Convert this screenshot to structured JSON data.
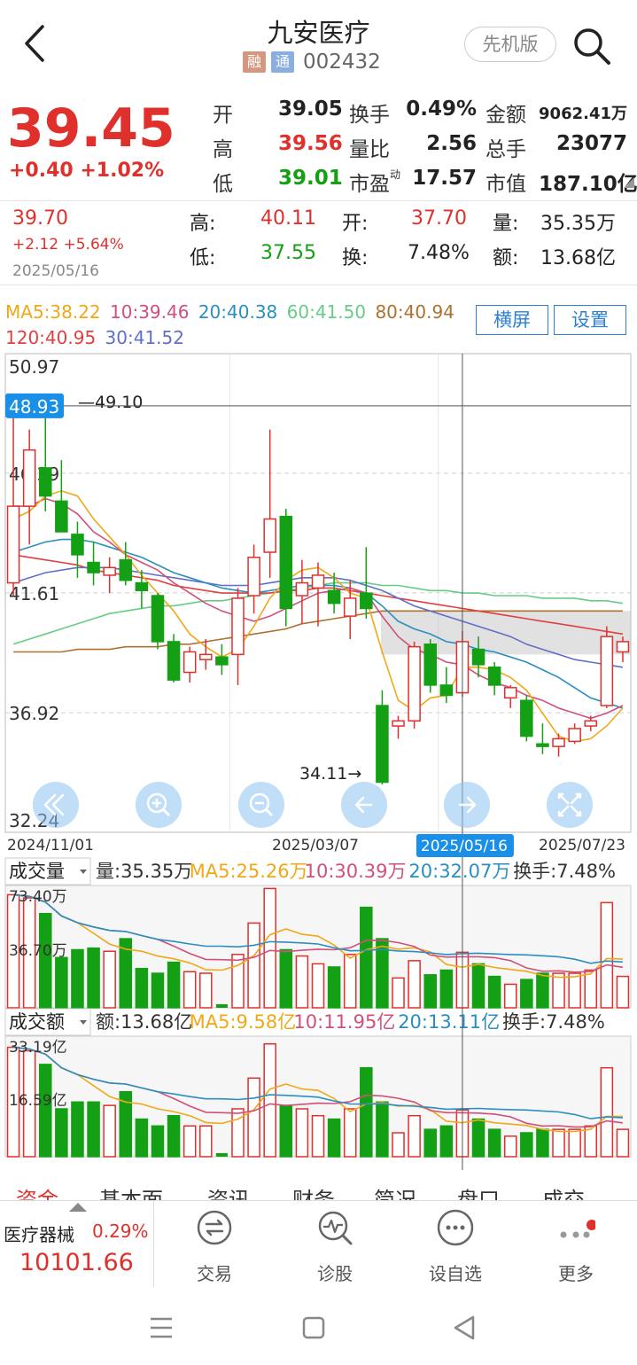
{
  "header": {
    "stock_name": "九安医疗",
    "tag_rong": "融",
    "tag_tong": "通",
    "stock_code": "002432",
    "version_label": "先机版"
  },
  "quote": {
    "price": "39.45",
    "change": "+0.40  +1.02%",
    "rows": [
      {
        "l1": "开",
        "v1": "39.05",
        "c1": "dark",
        "l2": "换手",
        "v2": "0.49%",
        "l3": "金额",
        "v3": "9062.41万"
      },
      {
        "l1": "高",
        "v1": "39.56",
        "c1": "red",
        "l2": "量比",
        "v2": "2.56",
        "l3": "总手",
        "v3": "23077"
      },
      {
        "l1": "低",
        "v1": "39.01",
        "c1": "green",
        "l2": "市盈",
        "v2": "17.57",
        "l3": "市值",
        "v3": "187.10亿"
      }
    ],
    "pe_superscript": "动"
  },
  "day_info": {
    "price": "39.70",
    "change": "+2.12  +5.64%",
    "date": "2025/05/16",
    "high_label": "高:",
    "high": "40.11",
    "open_label": "开:",
    "open": "37.70",
    "vol_label": "量:",
    "vol": "35.35万",
    "low_label": "低:",
    "low": "37.55",
    "turn_label": "换:",
    "turn": "7.48%",
    "amount_label": "额:",
    "amount": "13.68亿"
  },
  "ma_legend": {
    "ma5": "MA5:38.22",
    "ma10": "10:39.46",
    "ma20": "20:40.38",
    "ma60": "60:41.50",
    "ma80": "80:40.94",
    "ma120": "120:40.95",
    "ma30": "30:41.52"
  },
  "buttons": {
    "landscape": "横屏",
    "settings": "设置"
  },
  "colors": {
    "up": "#e0302c",
    "down": "#14a014",
    "ma5": "#f0a818",
    "ma10": "#d0507a",
    "ma20": "#2a8fc0",
    "ma30": "#6070c8",
    "ma60": "#66cc88",
    "ma80": "#b07030",
    "ma120": "#e04040",
    "crosshair": "#555555",
    "date_badge": "#1a8fe8"
  },
  "chart_data": [
    {
      "type": "candlestick",
      "title": "",
      "ylim": [
        32.24,
        50.97
      ],
      "y_ticks": [
        "50.97",
        "46.29",
        "41.61",
        "36.92",
        "32.24"
      ],
      "x_labels": [
        "2024/11/01",
        "2025/03/07",
        "2025/05/16",
        "2025/07/23"
      ],
      "crosshair_price": "48.93",
      "crosshair_date": "2025/05/16",
      "annotations": {
        "max": "49.10",
        "min": "34.11"
      },
      "candles": [
        {
          "o": 42.0,
          "h": 48.5,
          "l": 41.5,
          "c": 45.0
        },
        {
          "o": 45.0,
          "h": 48.0,
          "l": 43.5,
          "c": 47.2
        },
        {
          "o": 46.5,
          "h": 49.1,
          "l": 44.8,
          "c": 45.4
        },
        {
          "o": 45.2,
          "h": 46.8,
          "l": 44.0,
          "c": 44.0
        },
        {
          "o": 43.9,
          "h": 44.4,
          "l": 42.2,
          "c": 43.1
        },
        {
          "o": 42.8,
          "h": 43.6,
          "l": 41.9,
          "c": 42.4
        },
        {
          "o": 42.3,
          "h": 43.0,
          "l": 41.6,
          "c": 42.6
        },
        {
          "o": 42.9,
          "h": 43.6,
          "l": 41.9,
          "c": 42.1
        },
        {
          "o": 42.0,
          "h": 42.5,
          "l": 41.0,
          "c": 41.7
        },
        {
          "o": 41.5,
          "h": 41.6,
          "l": 39.4,
          "c": 39.7
        },
        {
          "o": 39.7,
          "h": 40.0,
          "l": 38.1,
          "c": 38.2
        },
        {
          "o": 38.5,
          "h": 39.5,
          "l": 38.1,
          "c": 39.3
        },
        {
          "o": 39.0,
          "h": 39.8,
          "l": 38.6,
          "c": 39.2
        },
        {
          "o": 39.1,
          "h": 39.6,
          "l": 38.4,
          "c": 38.8
        },
        {
          "o": 39.2,
          "h": 41.8,
          "l": 38.0,
          "c": 41.4
        },
        {
          "o": 41.5,
          "h": 43.5,
          "l": 40.8,
          "c": 43.0
        },
        {
          "o": 43.2,
          "h": 48.0,
          "l": 42.2,
          "c": 44.5
        },
        {
          "o": 44.6,
          "h": 44.9,
          "l": 40.3,
          "c": 41.0
        },
        {
          "o": 41.5,
          "h": 42.9,
          "l": 40.4,
          "c": 42.0
        },
        {
          "o": 41.8,
          "h": 42.8,
          "l": 40.3,
          "c": 42.3
        },
        {
          "o": 41.7,
          "h": 42.4,
          "l": 40.8,
          "c": 41.2
        },
        {
          "o": 40.7,
          "h": 42.1,
          "l": 39.8,
          "c": 41.4
        },
        {
          "o": 41.6,
          "h": 43.4,
          "l": 40.6,
          "c": 41.0
        },
        {
          "o": 37.2,
          "h": 37.8,
          "l": 34.11,
          "c": 34.2
        },
        {
          "o": 36.4,
          "h": 36.8,
          "l": 35.9,
          "c": 36.6
        },
        {
          "o": 36.6,
          "h": 39.7,
          "l": 36.3,
          "c": 39.5
        },
        {
          "o": 39.6,
          "h": 39.8,
          "l": 37.7,
          "c": 38.0
        },
        {
          "o": 38.0,
          "h": 38.7,
          "l": 37.3,
          "c": 37.6
        },
        {
          "o": 37.7,
          "h": 40.11,
          "l": 37.55,
          "c": 39.7
        },
        {
          "o": 39.4,
          "h": 39.9,
          "l": 38.3,
          "c": 38.8
        },
        {
          "o": 38.7,
          "h": 38.9,
          "l": 37.6,
          "c": 38.0
        },
        {
          "o": 37.5,
          "h": 38.0,
          "l": 37.1,
          "c": 37.9
        },
        {
          "o": 37.4,
          "h": 37.6,
          "l": 35.8,
          "c": 36.0
        },
        {
          "o": 35.7,
          "h": 36.5,
          "l": 35.3,
          "c": 35.6
        },
        {
          "o": 35.6,
          "h": 36.1,
          "l": 35.2,
          "c": 35.9
        },
        {
          "o": 35.8,
          "h": 36.5,
          "l": 35.7,
          "c": 36.3
        },
        {
          "o": 36.4,
          "h": 36.8,
          "l": 36.2,
          "c": 36.6
        },
        {
          "o": 37.2,
          "h": 40.3,
          "l": 37.1,
          "c": 39.9
        },
        {
          "o": 39.3,
          "h": 39.9,
          "l": 38.9,
          "c": 39.7
        }
      ],
      "ma_lines": {
        "ma5": [
          44.5,
          44.8,
          45.4,
          45.6,
          45.4,
          44.5,
          43.8,
          43.1,
          42.3,
          41.6,
          40.9,
          40.0,
          39.5,
          39.1,
          39.4,
          40.3,
          41.4,
          42.1,
          42.5,
          42.6,
          42.2,
          41.6,
          41.4,
          39.3,
          37.4,
          37.0,
          37.5,
          37.6,
          38.7,
          38.7,
          38.6,
          38.3,
          37.8,
          36.9,
          36.0,
          35.8,
          35.9,
          36.4,
          37.1
        ],
        "ma10": [
          45.0,
          45.0,
          45.3,
          45.1,
          44.7,
          44.0,
          43.6,
          43.1,
          42.8,
          42.5,
          42.0,
          41.6,
          41.2,
          40.9,
          40.7,
          40.5,
          40.7,
          41.0,
          41.3,
          41.6,
          41.7,
          41.8,
          41.6,
          40.7,
          39.9,
          39.4,
          39.2,
          38.9,
          38.8,
          38.4,
          38.1,
          37.9,
          37.6,
          37.4,
          37.1,
          36.9,
          36.7,
          36.9,
          37.2
        ],
        "ma20": [
          43.2,
          43.4,
          43.6,
          43.7,
          43.7,
          43.6,
          43.4,
          43.2,
          43.0,
          42.7,
          42.4,
          42.2,
          42.0,
          41.8,
          41.7,
          41.6,
          41.7,
          41.8,
          41.9,
          41.9,
          41.9,
          41.8,
          41.6,
          41.1,
          40.5,
          40.2,
          40.0,
          39.7,
          39.6,
          39.4,
          39.3,
          39.1,
          38.9,
          38.6,
          38.3,
          37.9,
          37.5,
          37.3,
          37.1
        ],
        "ma30": [
          42.0,
          42.2,
          42.4,
          42.5,
          42.6,
          42.6,
          42.6,
          42.5,
          42.4,
          42.3,
          42.2,
          42.1,
          42.0,
          41.9,
          41.9,
          41.9,
          42.0,
          42.1,
          42.2,
          42.2,
          42.2,
          42.1,
          41.9,
          41.7,
          41.4,
          41.1,
          40.9,
          40.7,
          40.5,
          40.3,
          40.1,
          39.9,
          39.6,
          39.4,
          39.2,
          39.0,
          38.9,
          38.8,
          38.7
        ],
        "ma60": [
          39.6,
          39.8,
          40.0,
          40.2,
          40.4,
          40.6,
          40.8,
          40.9,
          41.0,
          41.1,
          41.1,
          41.2,
          41.3,
          41.3,
          41.4,
          41.5,
          41.6,
          41.7,
          41.8,
          41.9,
          42.0,
          42.0,
          42.0,
          41.9,
          41.9,
          41.8,
          41.7,
          41.7,
          41.6,
          41.6,
          41.5,
          41.5,
          41.5,
          41.4,
          41.4,
          41.4,
          41.3,
          41.3,
          41.2
        ],
        "ma80": [
          39.3,
          39.3,
          39.3,
          39.3,
          39.4,
          39.4,
          39.4,
          39.5,
          39.5,
          39.5,
          39.6,
          39.6,
          39.7,
          39.8,
          39.9,
          40.0,
          40.1,
          40.2,
          40.4,
          40.5,
          40.6,
          40.7,
          40.8,
          40.9,
          40.9,
          40.9,
          40.9,
          40.9,
          40.9,
          40.9,
          40.9,
          40.9,
          40.9,
          40.9,
          40.9,
          40.9,
          40.9,
          40.9,
          40.9
        ],
        "ma120": [
          43.1,
          43.0,
          42.9,
          42.8,
          42.7,
          42.5,
          42.4,
          42.3,
          42.2,
          42.1,
          41.9,
          41.8,
          41.7,
          41.6,
          41.6,
          41.6,
          41.6,
          41.7,
          41.7,
          41.8,
          41.8,
          41.7,
          41.6,
          41.5,
          41.4,
          41.3,
          41.2,
          41.1,
          41.0,
          40.9,
          40.8,
          40.7,
          40.6,
          40.5,
          40.4,
          40.3,
          40.2,
          40.1,
          40.0
        ]
      }
    },
    {
      "type": "bar",
      "title": "成交量",
      "legend": {
        "vol": "量:35.35万",
        "ma5": "MA5:25.26万",
        "ma10": "10:30.39万",
        "ma20": "20:32.07万",
        "turn": "换手:7.48%"
      },
      "y_ticks": [
        "73.40万",
        "36.70万"
      ],
      "ylim": [
        0,
        73.4
      ],
      "values": [
        72,
        70,
        60,
        32,
        37,
        38,
        36,
        44,
        25,
        22,
        29,
        23,
        22,
        0,
        34,
        54,
        76,
        37,
        33,
        28,
        26,
        34,
        64,
        44,
        19,
        30,
        21,
        24,
        35.35,
        28,
        20,
        15,
        18,
        22,
        22,
        22,
        24,
        67,
        20
      ]
    },
    {
      "type": "bar",
      "title": "成交额",
      "legend": {
        "amount": "额:13.68亿",
        "ma5": "MA5:9.58亿",
        "ma10": "10:11.95亿",
        "ma20": "20:13.11亿",
        "turn": "换手:7.48%"
      },
      "y_ticks": [
        "33.19亿",
        "16.59亿"
      ],
      "ylim": [
        0,
        33.19
      ],
      "values": [
        32,
        31,
        27,
        14,
        16,
        16,
        15,
        19,
        11,
        9,
        12,
        9,
        9,
        0,
        14,
        23,
        33,
        15,
        14,
        12,
        11,
        14,
        26,
        16,
        7,
        12,
        8,
        9,
        13.68,
        11,
        8,
        6,
        7,
        8,
        8,
        8,
        9,
        26,
        8
      ]
    }
  ],
  "tabs": [
    "资金",
    "基本面",
    "资讯",
    "财务",
    "简况",
    "盘口",
    "成交"
  ],
  "sector": {
    "name": "医疗器械",
    "pct": "0.29%",
    "index": "10101.66"
  },
  "nav": [
    {
      "label": "交易",
      "icon": "exchange-icon"
    },
    {
      "label": "诊股",
      "icon": "diagnose-icon"
    },
    {
      "label": "设自选",
      "icon": "add-watchlist-icon"
    },
    {
      "label": "更多",
      "icon": "more-icon"
    }
  ]
}
